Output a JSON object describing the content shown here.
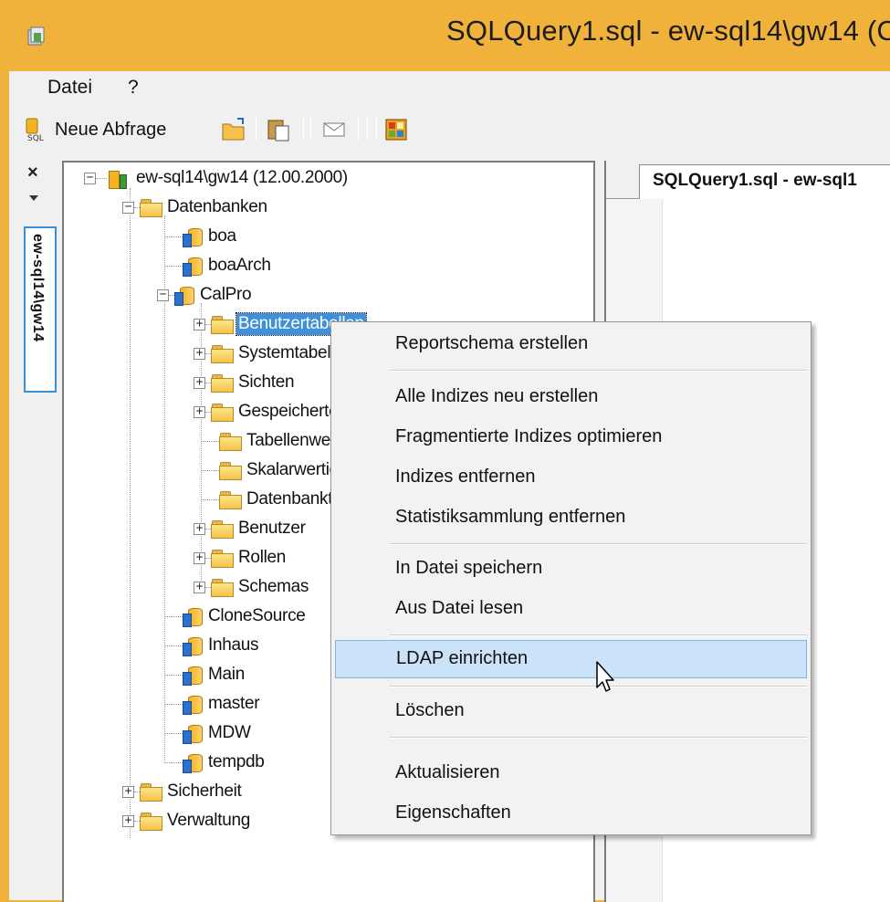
{
  "window": {
    "title": "SQLQuery1.sql - ew-sql14\\gw14 (C"
  },
  "menubar": {
    "items": [
      "Datei",
      "?"
    ]
  },
  "toolbar": {
    "new_query_label": "Neue Abfrage",
    "icons": [
      "new-query-icon",
      "open-icon",
      "paste-icon",
      "mail-icon",
      "grid-icon"
    ]
  },
  "side_panel": {
    "close_glyph": "×",
    "tab_label": "ew-sql14\\gw14"
  },
  "tree": {
    "server": "ew-sql14\\gw14 (12.00.2000)",
    "databases_folder": "Datenbanken",
    "items": [
      {
        "label": "boa"
      },
      {
        "label": "boaArch"
      },
      {
        "label": "CalPro"
      },
      {
        "label": "Benutzertabellen"
      },
      {
        "label": "Systemtabellen"
      },
      {
        "label": "Sichten"
      },
      {
        "label": "Gespeicherte Prozeduren"
      },
      {
        "label": "Tabellenwertige Funktionen"
      },
      {
        "label": "Skalarwertige Funktionen"
      },
      {
        "label": "Datenbanktrigger"
      },
      {
        "label": "Benutzer"
      },
      {
        "label": "Rollen"
      },
      {
        "label": "Schemas"
      },
      {
        "label": "CloneSource"
      },
      {
        "label": "Inhaus"
      },
      {
        "label": "Main"
      },
      {
        "label": "master"
      },
      {
        "label": "MDW"
      },
      {
        "label": "tempdb"
      },
      {
        "label": "Sicherheit"
      },
      {
        "label": "Verwaltung"
      }
    ]
  },
  "document": {
    "tab_label": "SQLQuery1.sql - ew-sql1"
  },
  "context_menu": {
    "items": [
      "Reportschema erstellen",
      "Alle Indizes neu erstellen",
      "Fragmentierte Indizes optimieren",
      "Indizes entfernen",
      "Statistiksammlung entfernen",
      "In Datei speichern",
      "Aus Datei lesen",
      "LDAP einrichten",
      "Löschen",
      "Aktualisieren",
      "Eigenschaften"
    ],
    "hovered": "LDAP einrichten"
  },
  "colors": {
    "title_bar": "#f0b23a",
    "selection": "#3f8fd9",
    "menu_hover": "#cbe3f8"
  }
}
